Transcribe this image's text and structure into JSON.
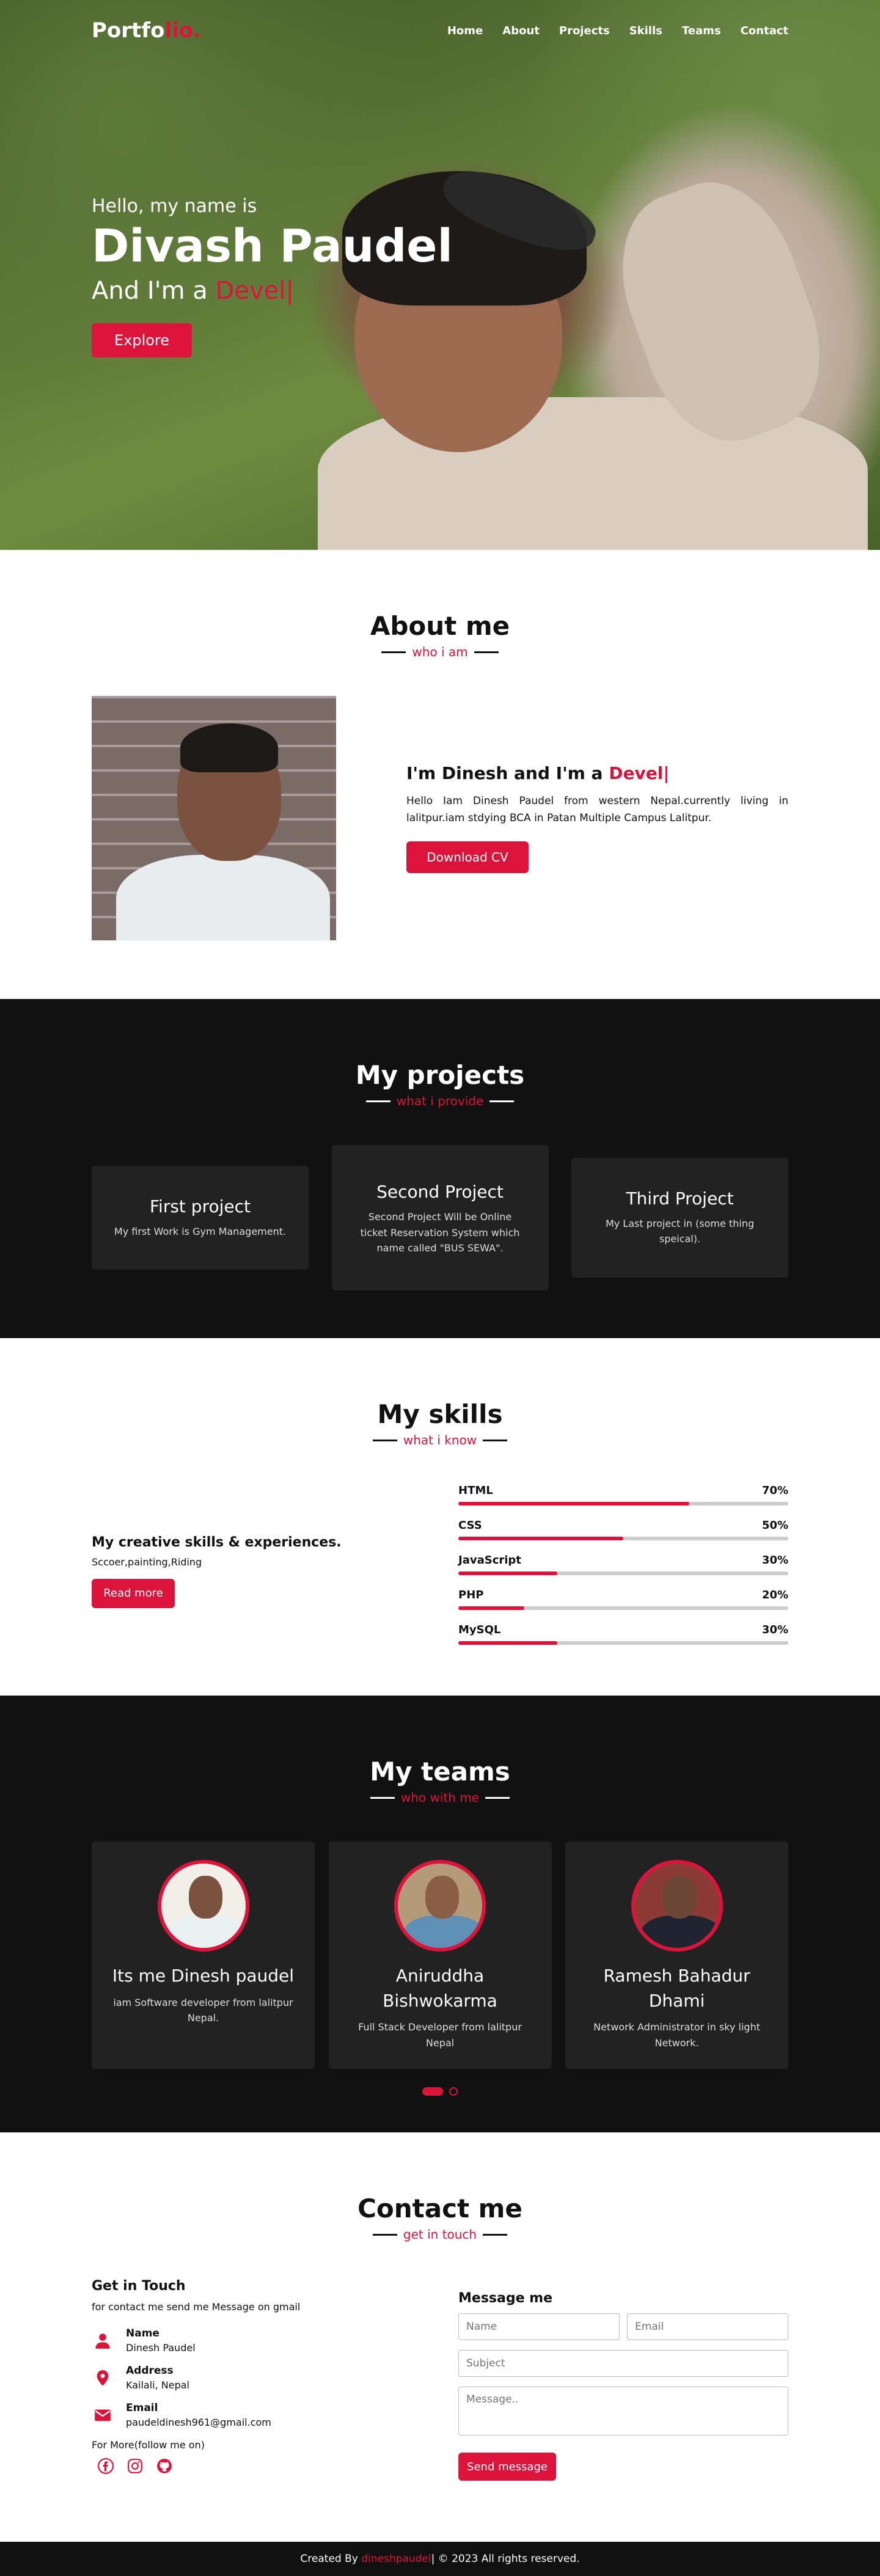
{
  "nav": {
    "logo_main": "Portfo",
    "logo_accent": "lio.",
    "items": [
      "Home",
      "About",
      "Projects",
      "Skills",
      "Teams",
      "Contact"
    ]
  },
  "hero": {
    "hello": "Hello, my name is",
    "name": "Divash Paudel",
    "role_prefix": "And I'm a ",
    "role_typed": "Devel|",
    "button": "Explore"
  },
  "about": {
    "title": "About me",
    "subtitle": "who i am",
    "heading_prefix": "I'm Dinesh and I'm a ",
    "heading_typed": "Devel|",
    "text": "Hello Iam Dinesh Paudel from western Nepal.currently living in lalitpur.iam stdying BCA in Patan Multiple Campus Lalitpur.",
    "button": "Download CV"
  },
  "projects": {
    "title": "My projects",
    "subtitle": "what i provide",
    "items": [
      {
        "title": "First project",
        "text": "My first Work is Gym Management."
      },
      {
        "title": "Second Project",
        "text": "Second Project Will be Online ticket Reservation System which name called \"BUS SEWA\"."
      },
      {
        "title": "Third Project",
        "text": "My Last project in (some thing speical)."
      }
    ]
  },
  "skills": {
    "title": "My skills",
    "subtitle": "what i know",
    "heading": "My creative skills & experiences.",
    "text": "Sccoer,painting,Riding",
    "button": "Read more",
    "bars": [
      {
        "name": "HTML",
        "percent": "70%",
        "value": 70
      },
      {
        "name": "CSS",
        "percent": "50%",
        "value": 50
      },
      {
        "name": "JavaScript",
        "percent": "30%",
        "value": 30
      },
      {
        "name": "PHP",
        "percent": "20%",
        "value": 20
      },
      {
        "name": "MySQL",
        "percent": "30%",
        "value": 30
      }
    ]
  },
  "teams": {
    "title": "My teams",
    "subtitle": "who with me",
    "members": [
      {
        "name": "Its me Dinesh paudel",
        "desc": "iam Software developer from lalitpur Nepal."
      },
      {
        "name": "Aniruddha Bishwokarma",
        "desc": "Full Stack Developer from lalitpur Nepal"
      },
      {
        "name": "Ramesh Bahadur Dhami",
        "desc": "Network Administrator in sky light Network."
      }
    ]
  },
  "contact": {
    "title": "Contact me",
    "subtitle": "get in touch",
    "get_in_touch": "Get in Touch",
    "intro": "for contact me send me Message on gmail",
    "name_label": "Name",
    "name_value": "Dinesh Paudel",
    "address_label": "Address",
    "address_value": "Kailali, Nepal",
    "email_label": "Email",
    "email_value": "paudeldinesh961@gmail.com",
    "follow": "For More(follow me on)",
    "message_title": "Message me",
    "placeholders": {
      "name": "Name",
      "email": "Email",
      "subject": "Subject",
      "message": "Message.."
    },
    "send_button": "Send message"
  },
  "footer": {
    "prefix": "Created By ",
    "name": "dineshpaudel",
    "suffix": " | © 2023 All rights reserved."
  },
  "colors": {
    "accent": "#dc143c",
    "dark": "#111111",
    "card": "#222222"
  }
}
